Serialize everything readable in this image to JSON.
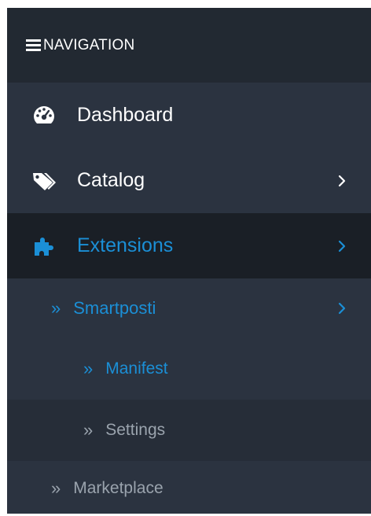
{
  "header": {
    "title": "NAVIGATION",
    "icon": "hamburger-icon"
  },
  "menu": {
    "dashboard": {
      "label": "Dashboard",
      "icon": "dashboard-icon"
    },
    "catalog": {
      "label": "Catalog",
      "icon": "tags-icon",
      "has_children": true
    },
    "extensions": {
      "label": "Extensions",
      "icon": "puzzle-icon",
      "has_children": true,
      "active": true
    },
    "smartposti": {
      "label": "Smartposti",
      "prefix": "»",
      "has_children": true
    },
    "manifest": {
      "label": "Manifest",
      "prefix": "»",
      "current": true
    },
    "settings": {
      "label": "Settings",
      "prefix": "»"
    },
    "marketplace": {
      "label": "Marketplace",
      "prefix": "»"
    }
  },
  "colors": {
    "accent": "#1b8fd6",
    "sidebar_bg": "#2b3340",
    "header_bg": "#222932",
    "active_bg": "#1a1f26",
    "muted_text": "#9aa3ad"
  }
}
